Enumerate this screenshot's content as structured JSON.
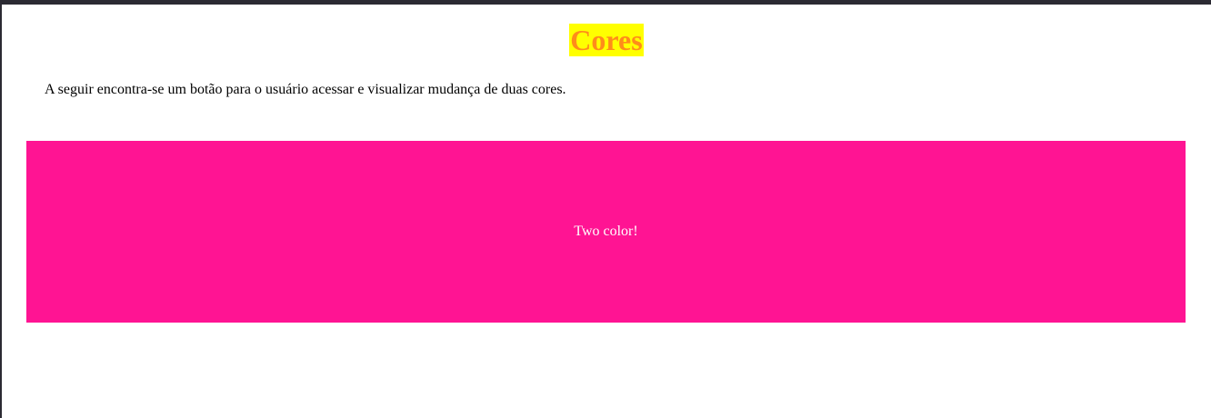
{
  "page": {
    "title": "Cores",
    "intro": "A seguir encontra-se um botão para o usuário acessar e visualizar mudança de duas cores."
  },
  "button": {
    "label": "Two color!"
  },
  "colors": {
    "title_text": "#ff8c1a",
    "title_background": "#ffff00",
    "button_background": "#ff1493",
    "button_text": "#ffffff",
    "window_border": "#2b2a33"
  }
}
